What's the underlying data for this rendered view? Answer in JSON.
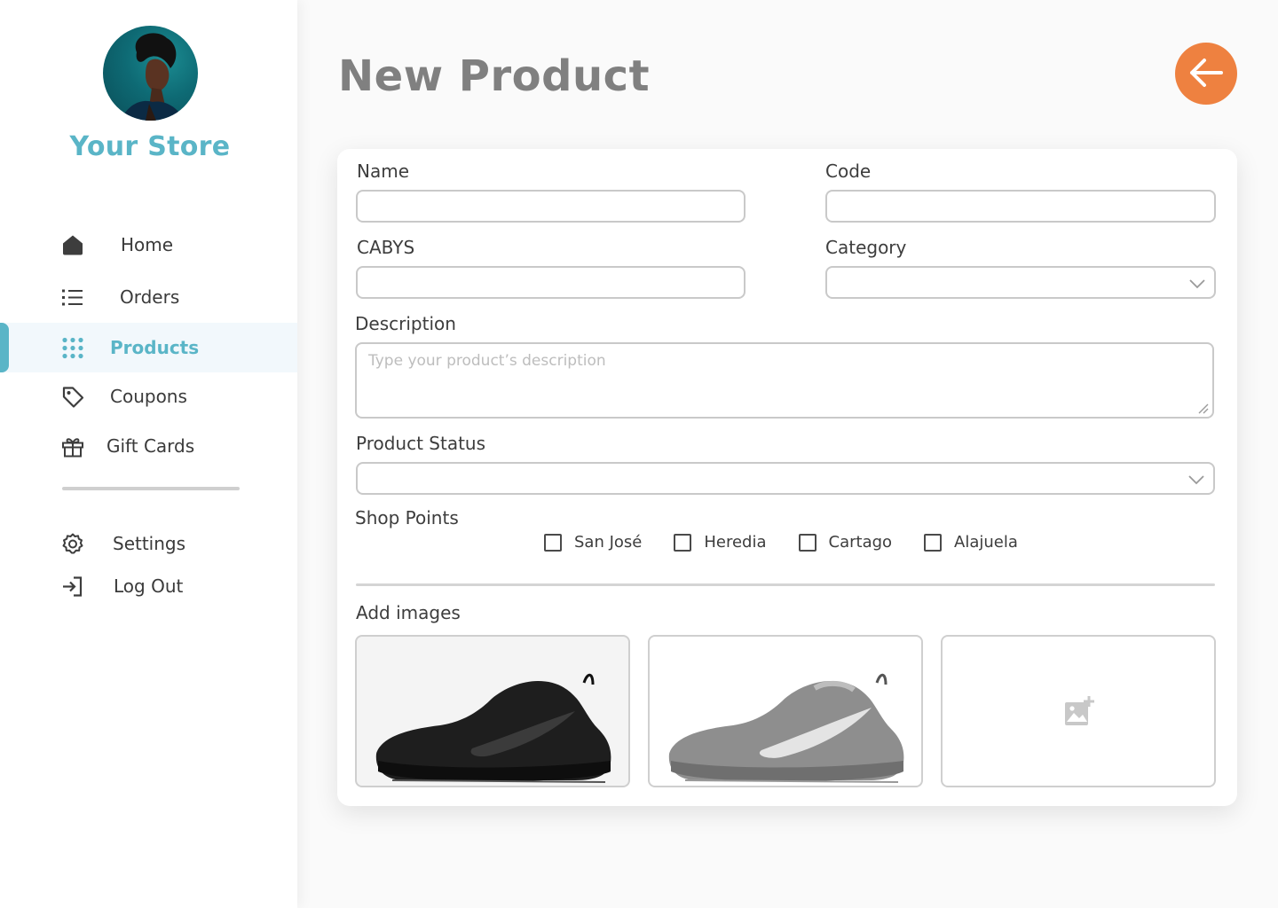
{
  "store": {
    "name": "Your Store"
  },
  "nav": {
    "items": [
      {
        "label": "Home",
        "icon": "home-icon"
      },
      {
        "label": "Orders",
        "icon": "list-icon"
      },
      {
        "label": "Products",
        "icon": "grid-dots-icon",
        "active": true
      },
      {
        "label": "Coupons",
        "icon": "tag-icon"
      },
      {
        "label": "Gift Cards",
        "icon": "gift-icon"
      }
    ],
    "secondary": [
      {
        "label": "Settings",
        "icon": "gear-icon"
      },
      {
        "label": "Log Out",
        "icon": "logout-icon"
      }
    ]
  },
  "page": {
    "title": "New Product"
  },
  "form": {
    "name_label": "Name",
    "code_label": "Code",
    "cabys_label": "CABYS",
    "category_label": "Category",
    "description_label": "Description",
    "description_placeholder": "Type your product’s description",
    "status_label": "Product Status",
    "shop_points_label": "Shop Points",
    "shop_points": [
      "San José",
      "Heredia",
      "Cartago",
      "Alajuela"
    ],
    "add_images_label": "Add images"
  },
  "colors": {
    "accent": "#5ab5c7",
    "back_button": "#ee8140",
    "title": "#808080"
  }
}
